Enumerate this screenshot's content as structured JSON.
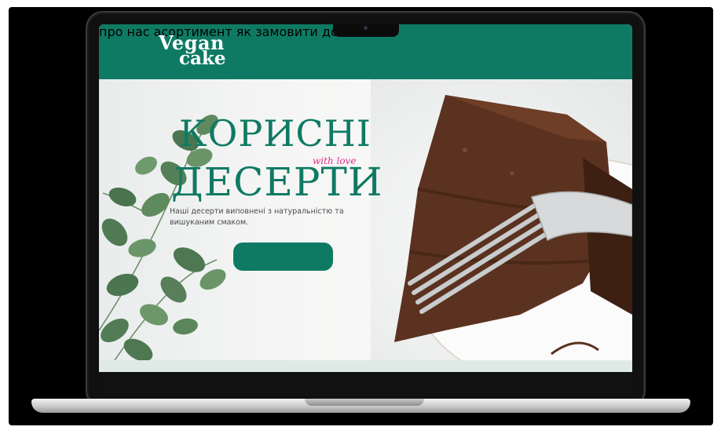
{
  "logo": {
    "line1": "Vegan",
    "line2": "cake"
  },
  "nav": [
    {
      "label": "про нас"
    },
    {
      "label": "асортимент"
    },
    {
      "label": "як замовити"
    },
    {
      "label": "доставка"
    }
  ],
  "hero": {
    "title_line1": "КОРИСНІ",
    "title_line2": "ДЕСЕРТИ",
    "tagline": "with love",
    "subtitle": "Наші десерти виповнені з натуральністю та вишуканим смаком.",
    "cta_label": ""
  },
  "colors": {
    "brand_green": "#0f7a64",
    "accent_pink": "#e0328e",
    "background": "#000000"
  },
  "icons": [
    "eucalyptus-branch",
    "chocolate-cake-slice",
    "fork"
  ]
}
